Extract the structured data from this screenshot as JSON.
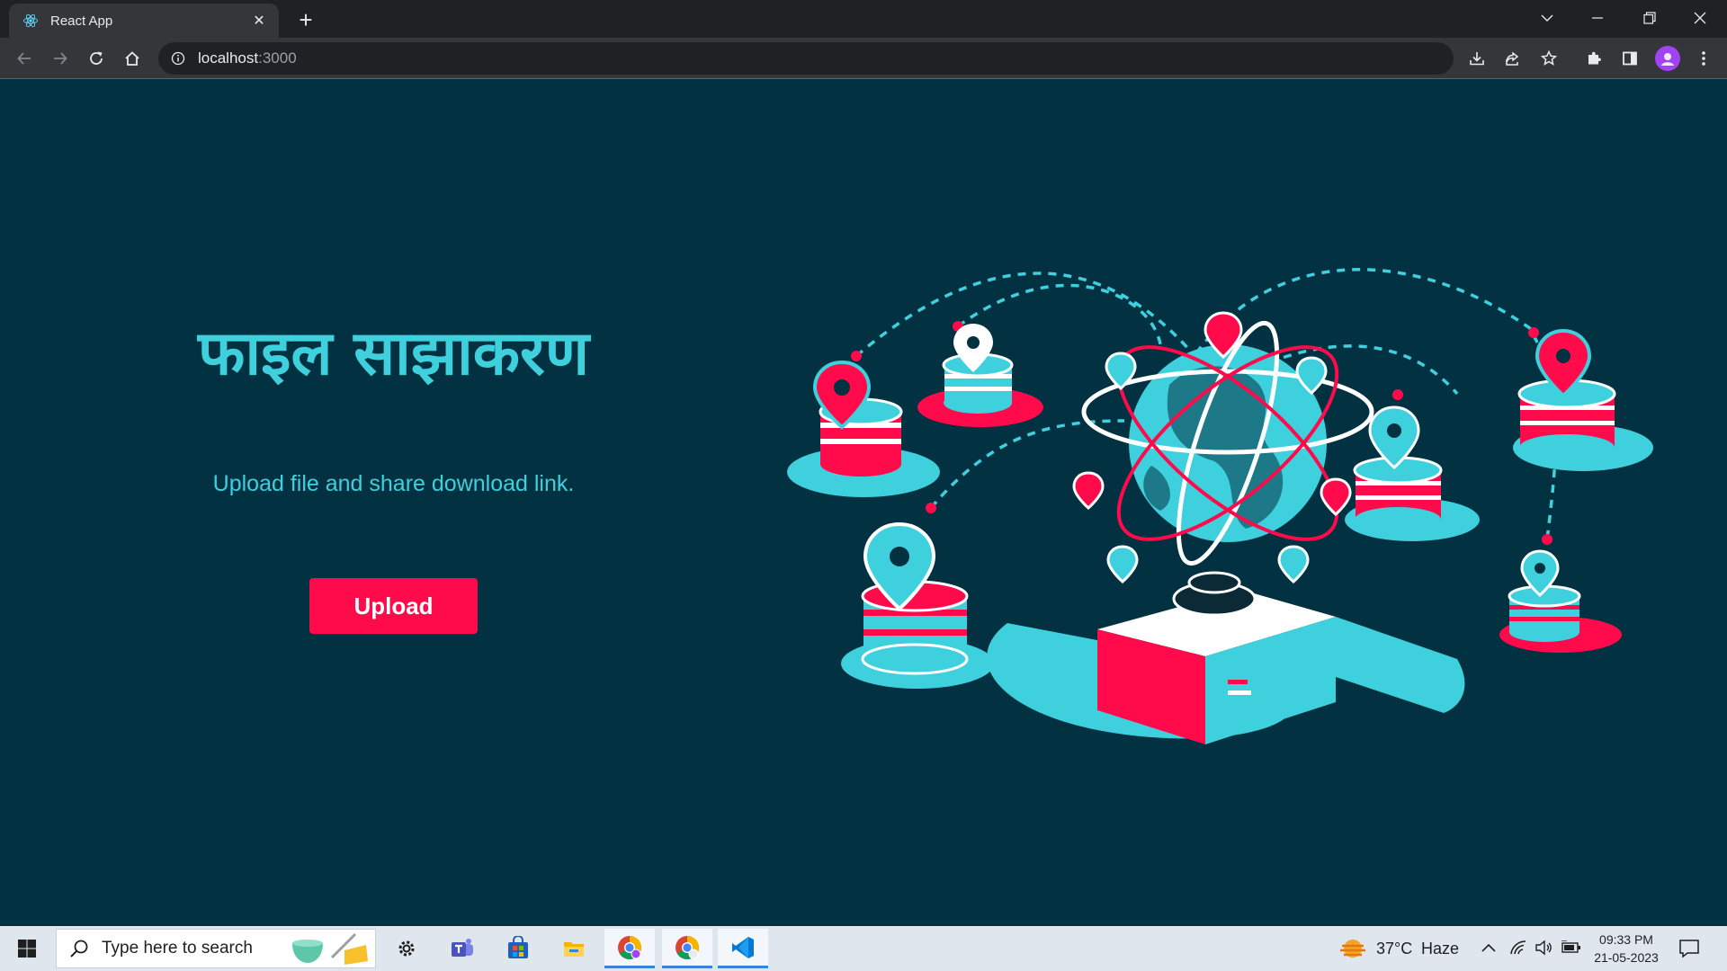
{
  "browser": {
    "tab": {
      "title": "React App"
    },
    "omnibox": {
      "host": "localhost",
      "port": ":3000"
    }
  },
  "page": {
    "title": "फाइल साझाकरण",
    "subtitle": "Upload file and share download link.",
    "upload_button": "Upload"
  },
  "taskbar": {
    "search_placeholder": "Type here to search",
    "weather": {
      "temp": "37°C",
      "condition": "Haze"
    },
    "clock": {
      "time": "09:33 PM",
      "date": "21-05-2023"
    }
  },
  "colors": {
    "page_bg": "#023141",
    "accent_cyan": "#3fd0de",
    "accent_red": "#ff0a4a"
  },
  "icons": {
    "tab_favicon": "react-icon",
    "windows_start": "windows-logo-icon",
    "taskbar_apps": [
      "settings-icon",
      "teams-icon",
      "store-icon",
      "file-explorer-icon",
      "chrome-icon",
      "chrome-icon",
      "vscode-icon"
    ]
  }
}
